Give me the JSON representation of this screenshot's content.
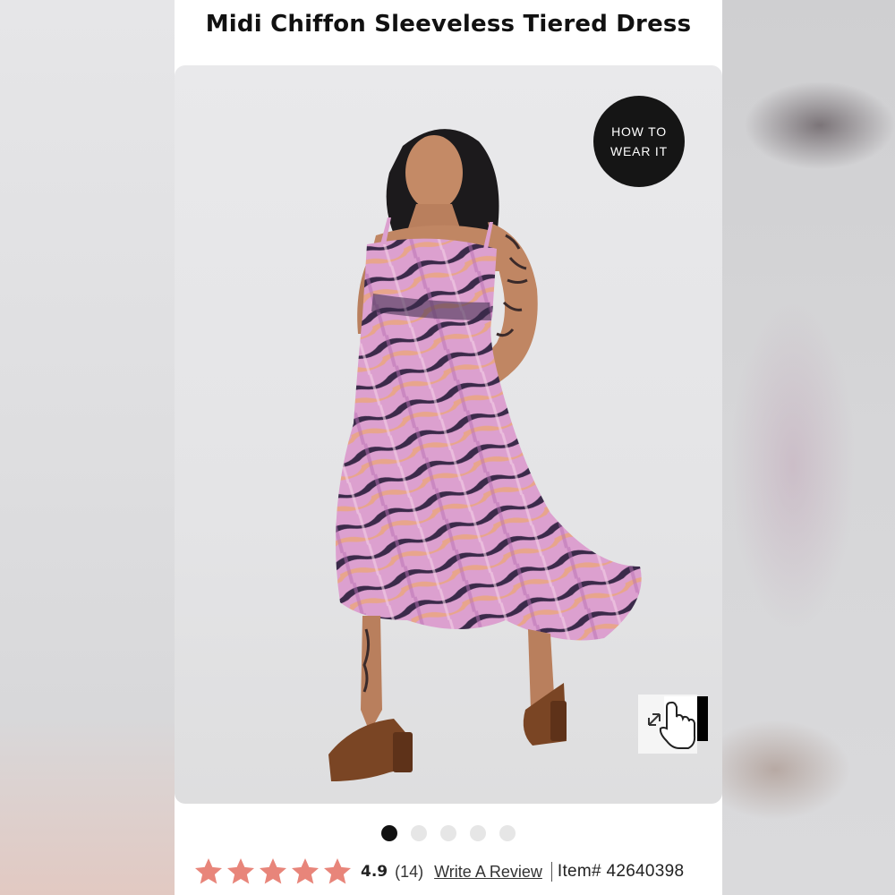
{
  "product": {
    "title": "Midi Chiffon Sleeveless Tiered Dress"
  },
  "gallery": {
    "how_to_wear_line1": "HOW TO",
    "how_to_wear_line2": "WEAR IT",
    "dot_count": 5,
    "active_index": 0,
    "zoom_icon": "expand-arrows-icon",
    "cursor_icon": "hand-pointer-icon"
  },
  "reviews": {
    "star_icon": "star-icon",
    "star_color": "#e8857a",
    "rating": "4.9",
    "count": "(14)",
    "write_review_label": "Write A Review",
    "item_label": "Item# 42640398"
  },
  "colors": {
    "dress_pink": "#d98fc9",
    "dress_dark": "#3b2a4a",
    "dress_peach": "#e8a58c",
    "sandal_brown": "#7a4524"
  }
}
